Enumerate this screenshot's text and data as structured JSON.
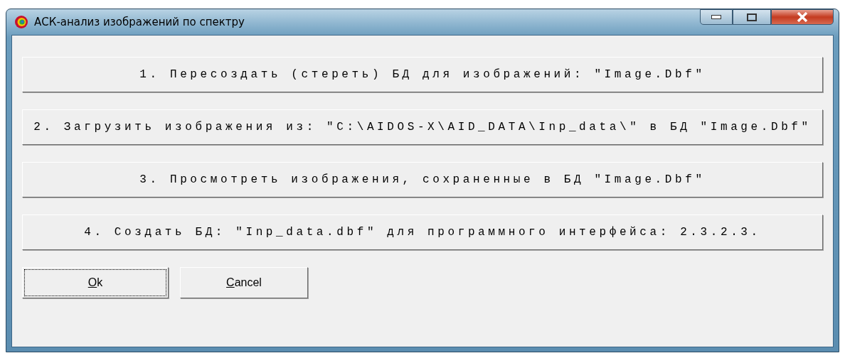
{
  "window": {
    "title": "АСК-анализ изображений по спектру"
  },
  "actions": [
    {
      "label": "1. Пересоздать (стереть) БД для изображений: \"Image.Dbf\""
    },
    {
      "label": "2. Загрузить изображения из: \"C:\\AIDOS-X\\AID_DATA\\Inp_data\\\" в БД \"Image.Dbf\""
    },
    {
      "label": "3. Просмотреть изображения, сохраненные в БД \"Image.Dbf\""
    },
    {
      "label": "4. Создать БД: \"Inp_data.dbf\" для программного интерфейса: 2.3.2.3."
    }
  ],
  "buttons": [
    {
      "label": "Ok",
      "focused": true
    },
    {
      "label": "Cancel",
      "focused": false
    }
  ]
}
